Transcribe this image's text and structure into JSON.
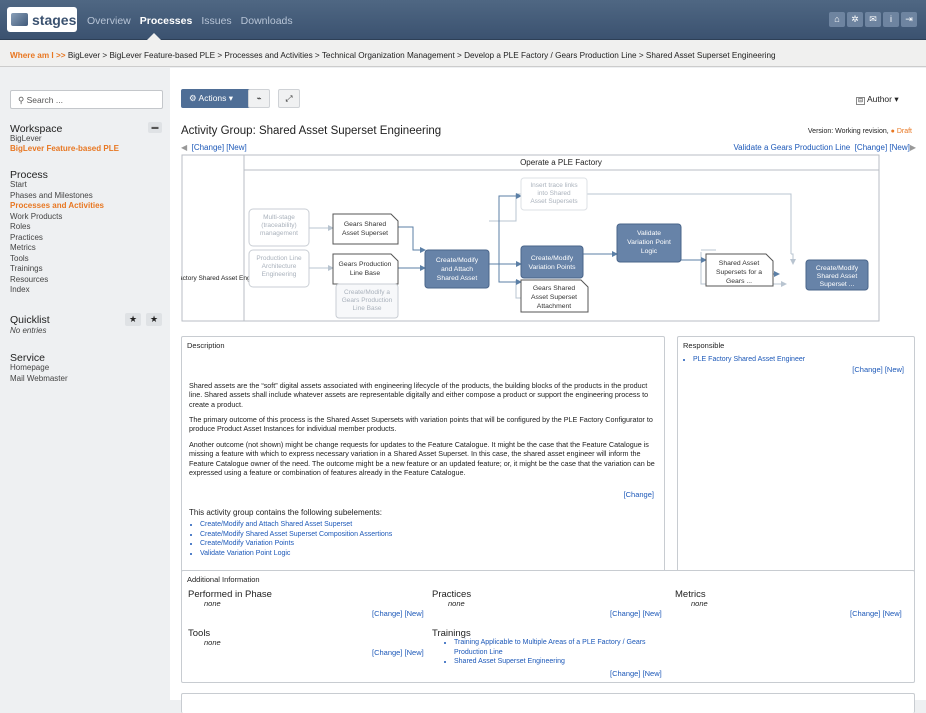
{
  "app": {
    "logo": "stages",
    "nav": [
      "Overview",
      "Processes",
      "Issues",
      "Downloads"
    ],
    "active_nav": "Processes"
  },
  "breadcrumb": {
    "label": "Where am I >>",
    "path": "BigLever > BigLever Feature-based PLE > Processes and Activities > Technical Organization Management > Develop a PLE Factory / Gears Production Line > Shared Asset Superset Engineering"
  },
  "sidebar": {
    "search": "Search ...",
    "workspace": {
      "title": "Workspace",
      "items": [
        "BigLever",
        "BigLever Feature-based PLE"
      ]
    },
    "process": {
      "title": "Process",
      "items": [
        "Start",
        "Phases and Milestones",
        "Processes and Activities",
        "Work Products",
        "Roles",
        "Practices",
        "Metrics",
        "Tools",
        "Trainings",
        "Resources",
        "Index"
      ]
    },
    "quicklist": {
      "title": "Quicklist",
      "empty": "No entries"
    },
    "service": {
      "title": "Service",
      "items": [
        "Homepage",
        "Mail Webmaster"
      ]
    }
  },
  "toolbar": {
    "actions": "Actions",
    "author": "Author"
  },
  "page": {
    "title": "Activity Group: Shared Asset Superset Engineering",
    "version_label": "Version: Working revision,",
    "version_state": "Draft",
    "prev_change": "[Change] [New]",
    "next_link": "Validate a Gears Production Line",
    "next_change": "[Change] [New]"
  },
  "diagram": {
    "header": "Operate a PLE Factory",
    "role": "PLE Factory Shared Asset Engineer",
    "nodes": {
      "multistage": "Multi-stage (traceability) management",
      "plarch": "Production Line Architecture Engineering",
      "gsas": "Gears Shared Asset Superset",
      "gplb": "Gears Production Line Base",
      "cmgpl": "Create/Modify a Gears Production Line Base",
      "cmattach": "Create/Modify and Attach Shared Asset",
      "trace": "Insert trace links into Shared Asset Supersets",
      "cmvp": "Create/Modify Variation Points",
      "gsasa": "Gears Shared Asset Superset Attachment",
      "vvpl": "Validate Variation Point Logic",
      "sasfg": "Shared Asset Supersets for a Gears ...",
      "cmsas": "Create/Modify Shared Asset Superset ..."
    }
  },
  "description": {
    "title": "Description",
    "p1": "Shared assets are the “soft” digital assets associated with engineering lifecycle of the products, the building blocks of the products in the product line. Shared assets shall include whatever assets are representable digitally and either compose a product or support the engineering process to create a product.",
    "p2": "The primary outcome of this process is the Shared Asset Supersets with variation points that will be configured by the PLE Factory Configurator to produce Product Asset Instances for individual member products.",
    "p3": "Another outcome (not shown) might be change requests for updates to the Feature Catalogue. It might be the case that the Feature Catalogue is missing a feature with which to express necessary variation in a Shared Asset Superset. In this case, the shared asset engineer will inform the Feature Catalogue owner of the need. The outcome might be a new feature or an updated feature; or, it might be the case that the variation can be expressed using a feature or combination of features already in the Feature Catalogue.",
    "change": "[Change]",
    "sub_title": "This activity group contains the following subelements:",
    "subelements": [
      "Create/Modify and Attach Shared Asset Superset",
      "Create/Modify Shared Asset Superset Composition Assertions",
      "Create/Modify Variation Points",
      "Validate Variation Point Logic"
    ]
  },
  "responsible": {
    "title": "Responsible",
    "items": [
      "PLE Factory Shared Asset Engineer"
    ],
    "change": "[Change] [New]"
  },
  "additional": {
    "title": "Additional Information",
    "phase": {
      "label": "Performed in Phase",
      "value": "none",
      "change": "[Change] [New]"
    },
    "practices": {
      "label": "Practices",
      "value": "none",
      "change": "[Change] [New]"
    },
    "metrics": {
      "label": "Metrics",
      "value": "none",
      "change": "[Change] [New]"
    },
    "tools": {
      "label": "Tools",
      "value": "none",
      "change": "[Change] [New]"
    },
    "trainings": {
      "label": "Trainings",
      "items": [
        "Training Applicable to Multiple Areas of a PLE Factory / Gears Production Line",
        "Shared Asset Superset Engineering"
      ],
      "change": "[Change] [New]"
    }
  }
}
